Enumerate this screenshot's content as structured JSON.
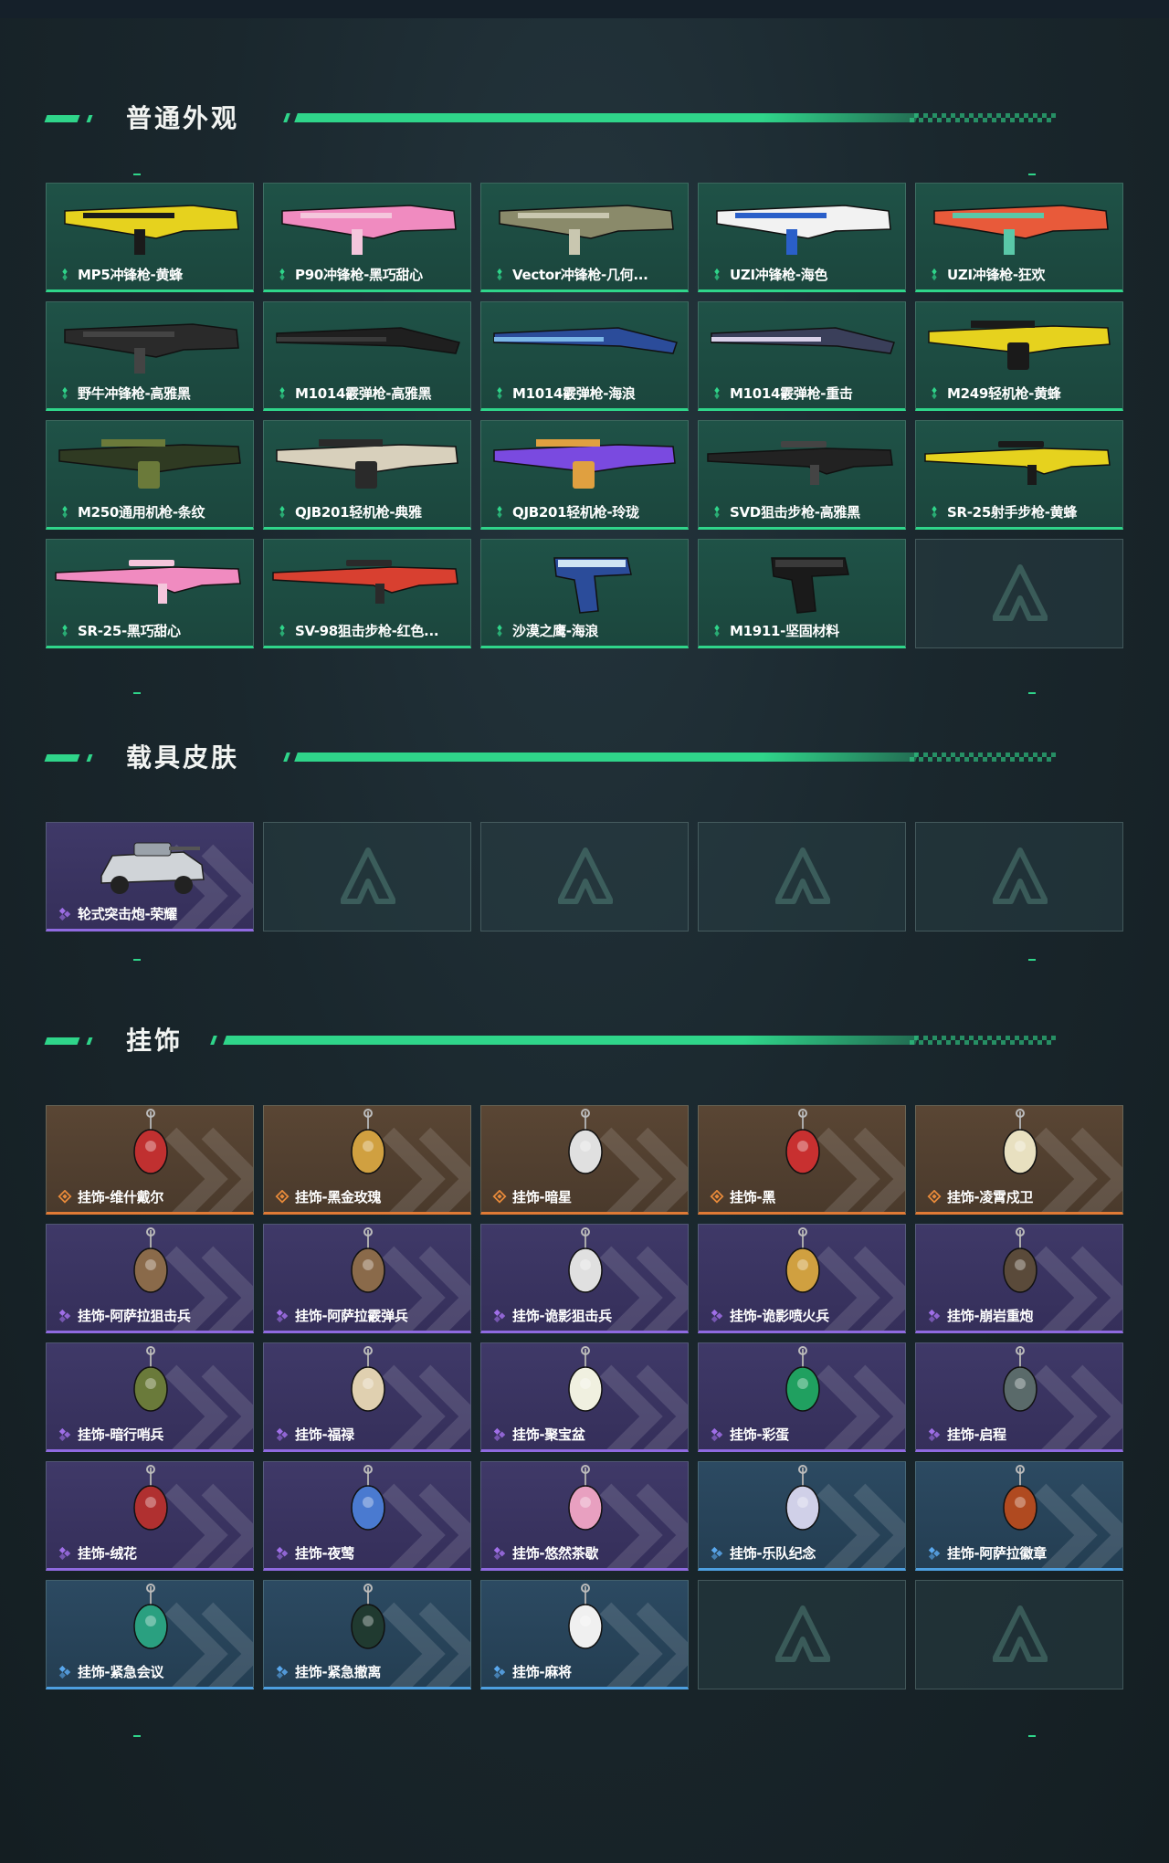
{
  "colors": {
    "accent": "#2fd58a",
    "rarity_green": "#2fd58a",
    "rarity_purple": "#8f6ae0",
    "rarity_gold": "#e07a35",
    "rarity_blue": "#4d9fe0"
  },
  "sections": {
    "weapon_skins": {
      "title": "普通外观",
      "items": [
        {
          "label": "MP5冲锋枪-黄蜂",
          "rarity": "green",
          "icon": "smg-icon"
        },
        {
          "label": "P90冲锋枪-黑巧甜心",
          "rarity": "green",
          "icon": "smg-icon"
        },
        {
          "label": "Vector冲锋枪-几何...",
          "rarity": "green",
          "icon": "smg-icon"
        },
        {
          "label": "UZI冲锋枪-海色",
          "rarity": "green",
          "icon": "smg-icon"
        },
        {
          "label": "UZI冲锋枪-狂欢",
          "rarity": "green",
          "icon": "smg-icon"
        },
        {
          "label": "野牛冲锋枪-高雅黑",
          "rarity": "green",
          "icon": "smg-icon"
        },
        {
          "label": "M1014霰弹枪-高雅黑",
          "rarity": "green",
          "icon": "shotgun-icon"
        },
        {
          "label": "M1014霰弹枪-海浪",
          "rarity": "green",
          "icon": "shotgun-icon"
        },
        {
          "label": "M1014霰弹枪-重击",
          "rarity": "green",
          "icon": "shotgun-icon"
        },
        {
          "label": "M249轻机枪-黄蜂",
          "rarity": "green",
          "icon": "lmg-icon"
        },
        {
          "label": "M250通用机枪-条纹",
          "rarity": "green",
          "icon": "lmg-icon"
        },
        {
          "label": "QJB201轻机枪-典雅",
          "rarity": "green",
          "icon": "lmg-icon"
        },
        {
          "label": "QJB201轻机枪-玲珑",
          "rarity": "green",
          "icon": "lmg-icon"
        },
        {
          "label": "SVD狙击步枪-高雅黑",
          "rarity": "green",
          "icon": "sniper-icon"
        },
        {
          "label": "SR-25射手步枪-黄蜂",
          "rarity": "green",
          "icon": "sniper-icon"
        },
        {
          "label": "SR-25-黑巧甜心",
          "rarity": "green",
          "icon": "rifle-icon"
        },
        {
          "label": "SV-98狙击步枪-红色...",
          "rarity": "green",
          "icon": "sniper-icon"
        },
        {
          "label": "沙漠之鹰-海浪",
          "rarity": "green",
          "icon": "pistol-icon"
        },
        {
          "label": "M1911-坚固材料",
          "rarity": "green",
          "icon": "pistol-icon"
        },
        {
          "label": "",
          "rarity": "empty",
          "icon": "empty-slot-logo-icon"
        }
      ]
    },
    "vehicle_skins": {
      "title": "载具皮肤",
      "items": [
        {
          "label": "轮式突击炮-荣耀",
          "rarity": "purple",
          "icon": "vehicle-icon"
        },
        {
          "label": "",
          "rarity": "empty",
          "icon": "empty-slot-logo-icon"
        },
        {
          "label": "",
          "rarity": "empty",
          "icon": "empty-slot-logo-icon"
        },
        {
          "label": "",
          "rarity": "empty",
          "icon": "empty-slot-logo-icon"
        },
        {
          "label": "",
          "rarity": "empty",
          "icon": "empty-slot-logo-icon"
        }
      ]
    },
    "charms": {
      "title": "挂饰",
      "items": [
        {
          "label": "挂饰-维什戴尔",
          "rarity": "gold",
          "icon": "charm-icon"
        },
        {
          "label": "挂饰-黑金玫瑰",
          "rarity": "gold",
          "icon": "charm-icon"
        },
        {
          "label": "挂饰-暗星",
          "rarity": "gold",
          "icon": "charm-icon"
        },
        {
          "label": "挂饰-黑",
          "rarity": "gold",
          "icon": "charm-icon"
        },
        {
          "label": "挂饰-凌霄戍卫",
          "rarity": "gold",
          "icon": "charm-icon"
        },
        {
          "label": "挂饰-阿萨拉狙击兵",
          "rarity": "purple",
          "icon": "charm-icon"
        },
        {
          "label": "挂饰-阿萨拉霰弹兵",
          "rarity": "purple",
          "icon": "charm-icon"
        },
        {
          "label": "挂饰-诡影狙击兵",
          "rarity": "purple",
          "icon": "charm-icon"
        },
        {
          "label": "挂饰-诡影喷火兵",
          "rarity": "purple",
          "icon": "charm-icon"
        },
        {
          "label": "挂饰-崩岩重炮",
          "rarity": "purple",
          "icon": "charm-icon"
        },
        {
          "label": "挂饰-暗行哨兵",
          "rarity": "purple",
          "icon": "charm-icon"
        },
        {
          "label": "挂饰-福禄",
          "rarity": "purple",
          "icon": "charm-icon"
        },
        {
          "label": "挂饰-聚宝盆",
          "rarity": "purple",
          "icon": "charm-icon"
        },
        {
          "label": "挂饰-彩蛋",
          "rarity": "purple",
          "icon": "charm-icon"
        },
        {
          "label": "挂饰-启程",
          "rarity": "purple",
          "icon": "charm-icon"
        },
        {
          "label": "挂饰-绒花",
          "rarity": "purple",
          "icon": "charm-icon"
        },
        {
          "label": "挂饰-夜莺",
          "rarity": "purple",
          "icon": "charm-icon"
        },
        {
          "label": "挂饰-悠然茶歇",
          "rarity": "purple",
          "icon": "charm-icon"
        },
        {
          "label": "挂饰-乐队纪念",
          "rarity": "blue",
          "icon": "charm-icon"
        },
        {
          "label": "挂饰-阿萨拉徽章",
          "rarity": "blue",
          "icon": "charm-icon"
        },
        {
          "label": "挂饰-紧急会议",
          "rarity": "blue",
          "icon": "charm-icon"
        },
        {
          "label": "挂饰-紧急撤离",
          "rarity": "blue",
          "icon": "charm-icon"
        },
        {
          "label": "挂饰-麻将",
          "rarity": "blue",
          "icon": "charm-icon"
        },
        {
          "label": "",
          "rarity": "empty",
          "icon": "empty-slot-logo-icon"
        },
        {
          "label": "",
          "rarity": "empty",
          "icon": "empty-slot-logo-icon"
        }
      ]
    }
  }
}
